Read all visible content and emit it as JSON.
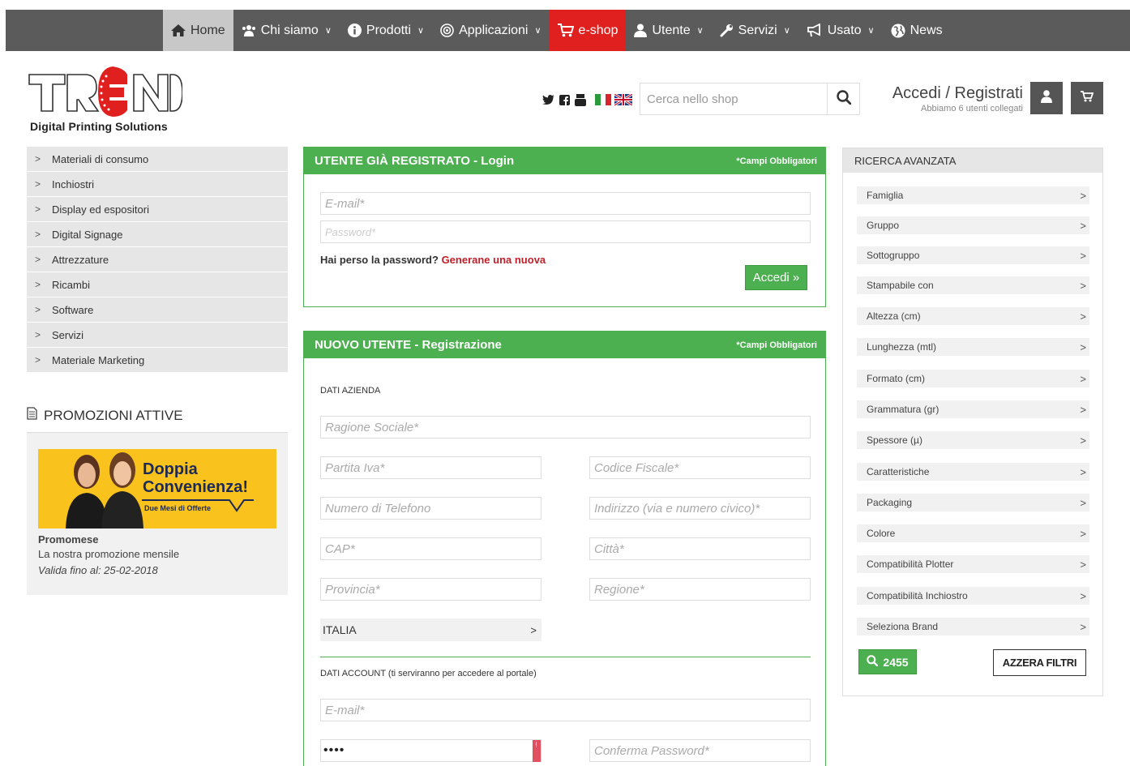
{
  "nav": {
    "items": [
      {
        "label": "Home",
        "icon": "home-icon",
        "dropdown": false
      },
      {
        "label": "Chi siamo",
        "icon": "users-icon",
        "dropdown": true
      },
      {
        "label": "Prodotti",
        "icon": "info-icon",
        "dropdown": true
      },
      {
        "label": "Applicazioni",
        "icon": "target-icon",
        "dropdown": true
      },
      {
        "label": "e-shop",
        "icon": "cart-icon",
        "dropdown": false
      },
      {
        "label": "Utente",
        "icon": "user-icon",
        "dropdown": true
      },
      {
        "label": "Servizi",
        "icon": "wrench-icon",
        "dropdown": true
      },
      {
        "label": "Usato",
        "icon": "megaphone-icon",
        "dropdown": true
      },
      {
        "label": "News",
        "icon": "globe-icon",
        "dropdown": false
      }
    ],
    "colors": {
      "bar": "#5b5b5b",
      "active": "#c8c8c8",
      "eshop": "#e0201f"
    }
  },
  "header": {
    "logo_text": "TREND",
    "logo_tagline": "Digital Printing Solutions",
    "search_placeholder": "Cerca nello shop",
    "account_link": "Accedi / Registrati",
    "users_online": "Abbiamo 6 utenti collegati"
  },
  "categories": [
    "Materiali di consumo",
    "Inchiostri",
    "Display ed espositori",
    "Digital Signage",
    "Attrezzature",
    "Ricambi",
    "Software",
    "Servizi",
    "Materiale Marketing"
  ],
  "promotions": {
    "title": "PROMOZIONI ATTIVE",
    "banner_line1": "Doppia",
    "banner_line2": "Convenienza!",
    "banner_sub": "Due Mesi di Offerte",
    "name": "Promomese",
    "description": "La nostra promozione mensile",
    "valid": "Valida fino al: 25-02-2018"
  },
  "login": {
    "title": "UTENTE GIÀ REGISTRATO - Login",
    "required": "*Campi Obbligatori",
    "email_placeholder": "E-mail*",
    "password_placeholder": "Password*",
    "forgot_text": "Hai perso la password?",
    "forgot_link": "Generane una nuova",
    "submit": "Accedi »"
  },
  "registration": {
    "title": "NUOVO UTENTE - Registrazione",
    "required": "*Campi Obbligatori",
    "company_section": "DATI AZIENDA",
    "ragione_sociale": "Ragione Sociale*",
    "partita_iva": "Partita Iva*",
    "codice_fiscale": "Codice Fiscale*",
    "telefono": "Numero di Telefono",
    "indirizzo": "Indirizzo (via e numero civico)*",
    "cap": "CAP*",
    "citta": "Città*",
    "provincia": "Provincia*",
    "regione": "Regione*",
    "country": "ITALIA",
    "account_section": "DATI ACCOUNT (ti serviranno per accedere al portale)",
    "email": "E-mail*",
    "password_value": "••••",
    "confirm_password": "Conferma Password*"
  },
  "filters": {
    "title": "RICERCA AVANZATA",
    "items": [
      "Famiglia",
      "Gruppo",
      "Sottogruppo",
      "Stampabile con",
      "Altezza (cm)",
      "Lunghezza (mtl)",
      "Formato (cm)",
      "Grammatura (gr)",
      "Spessore (µ)",
      "Caratteristiche",
      "Packaging",
      "Colore",
      "Compatibilità Plotter",
      "Compatibilità Inchiostro",
      "Seleziona Brand"
    ],
    "result_count": "2455",
    "reset": "AZZERA FILTRI"
  },
  "theme": {
    "green": "#4caf50",
    "red_link": "#c0202a"
  }
}
